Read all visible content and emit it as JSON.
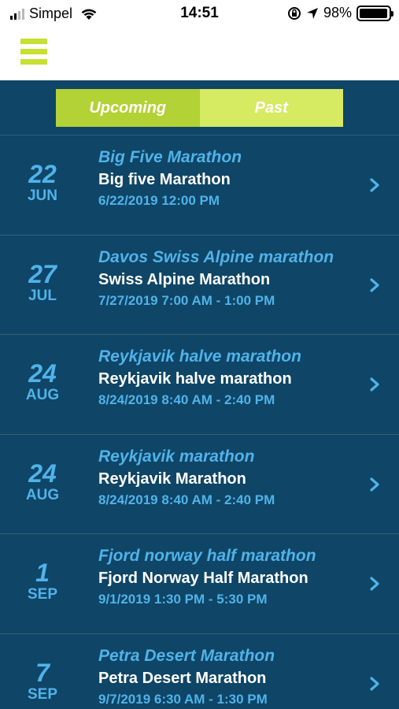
{
  "status_bar": {
    "carrier": "Simpel",
    "time": "14:51",
    "battery_text": "98%",
    "battery_level": 0.98
  },
  "header": {
    "menu_icon": "hamburger-menu-icon",
    "accent_color": "#c7e033"
  },
  "tabs": [
    {
      "label": "Upcoming",
      "selected": true
    },
    {
      "label": "Past",
      "selected": false
    }
  ],
  "events": [
    {
      "day": "22",
      "month": "JUN",
      "title": "Big Five Marathon",
      "subtitle": "Big five Marathon",
      "time": "6/22/2019 12:00 PM"
    },
    {
      "day": "27",
      "month": "JUL",
      "title": "Davos Swiss Alpine marathon",
      "subtitle": "Swiss Alpine Marathon",
      "time": "7/27/2019 7:00 AM - 1:00 PM"
    },
    {
      "day": "24",
      "month": "AUG",
      "title": "Reykjavik halve marathon",
      "subtitle": "Reykjavik halve marathon",
      "time": "8/24/2019 8:40 AM - 2:40 PM"
    },
    {
      "day": "24",
      "month": "AUG",
      "title": "Reykjavik marathon",
      "subtitle": "Reykjavik Marathon",
      "time": "8/24/2019 8:40 AM - 2:40 PM"
    },
    {
      "day": "1",
      "month": "SEP",
      "title": "Fjord norway half marathon",
      "subtitle": "Fjord Norway Half Marathon",
      "time": "9/1/2019 1:30 PM - 5:30 PM"
    },
    {
      "day": "7",
      "month": "SEP",
      "title": "Petra Desert Marathon",
      "subtitle": "Petra Desert Marathon",
      "time": "9/7/2019 6:30 AM - 1:30 PM"
    }
  ],
  "colors": {
    "background": "#0f4566",
    "accent_blue": "#4fb3ea",
    "tab_active": "#b2d235",
    "tab_inactive": "#d6ea62"
  }
}
